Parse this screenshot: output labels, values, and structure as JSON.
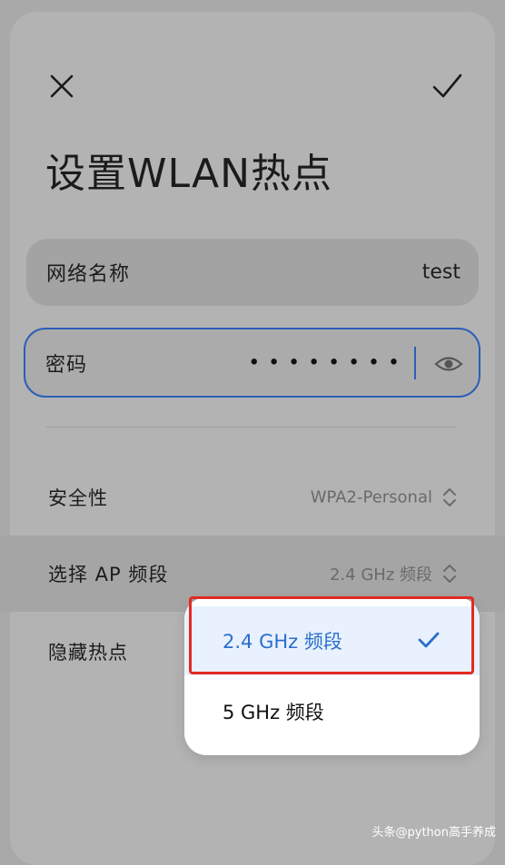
{
  "page": {
    "title": "设置WLAN热点",
    "close_icon": "close-icon",
    "confirm_icon": "checkmark-icon"
  },
  "form": {
    "ssid": {
      "label": "网络名称",
      "value": "test"
    },
    "password": {
      "label": "密码",
      "masked_value": "••••••••",
      "visibility_icon": "eye-icon"
    }
  },
  "settings": {
    "security": {
      "label": "安全性",
      "value": "WPA2-Personal"
    },
    "ap_band": {
      "label": "选择 AP 频段",
      "value": "2.4 GHz 频段"
    },
    "hidden_hotspot": {
      "label": "隐藏热点"
    }
  },
  "band_dropdown": {
    "options": [
      {
        "label": "2.4 GHz 频段",
        "selected": true
      },
      {
        "label": "5 GHz 频段",
        "selected": false
      }
    ]
  },
  "watermark": "头条@python高手养成",
  "colors": {
    "accent": "#2a6fcc",
    "highlight": "#e32a22",
    "dropdown_selected_bg": "#e8f1fd"
  }
}
